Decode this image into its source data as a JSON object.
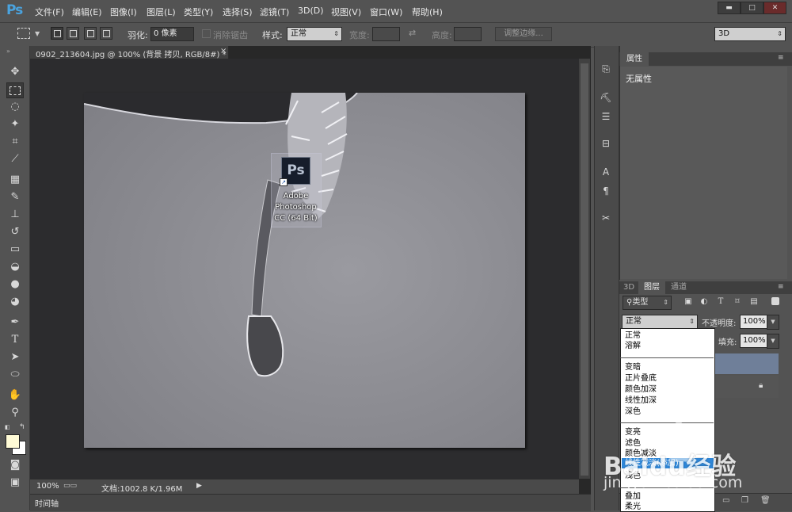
{
  "app": {
    "logo": "Ps"
  },
  "menu": [
    "文件(F)",
    "编辑(E)",
    "图像(I)",
    "图层(L)",
    "类型(Y)",
    "选择(S)",
    "滤镜(T)",
    "3D(D)",
    "视图(V)",
    "窗口(W)",
    "帮助(H)"
  ],
  "window_controls": {
    "minimize": "▬",
    "maximize": "□",
    "close": "✕"
  },
  "options": {
    "feather_label": "羽化:",
    "feather_value": "0 像素",
    "antialias_label": "消除锯齿",
    "style_label": "样式:",
    "style_value": "正常",
    "width_label": "宽度:",
    "height_label": "高度:",
    "refine_edge": "调整边缘...",
    "workspace": "3D"
  },
  "document": {
    "tab_title": "0902_213604.jpg @ 100% (背景 拷贝, RGB/8#) *",
    "close_glyph": "×",
    "zoom": "100%",
    "doc_size": "文档:1002.8 K/1.96M",
    "timeline": "时间轴"
  },
  "desktop_shortcut": {
    "icon_text": "Ps",
    "line1": "Adobe",
    "line2": "Photoshop",
    "line3": "CC (64 Bit)"
  },
  "properties": {
    "tab": "属性",
    "empty_text": "无属性"
  },
  "layers": {
    "tabs": [
      "3D",
      "图层",
      "通道"
    ],
    "filter_label": "类型",
    "blend_mode": "正常",
    "opacity_label": "不透明度:",
    "opacity_value": "100%",
    "fill_label": "填充:",
    "fill_value": "100%"
  },
  "blend_modes": {
    "group1": [
      "正常",
      "溶解"
    ],
    "group2": [
      "变暗",
      "正片叠底",
      "颜色加深",
      "线性加深",
      "深色"
    ],
    "group3": [
      "变亮",
      "滤色",
      "颜色减淡",
      "线性减淡(添加)",
      "浅色"
    ],
    "group4": [
      "叠加",
      "柔光"
    ],
    "highlighted": "线性减淡(添加)"
  },
  "watermark": {
    "logo": "Baidu经验",
    "url": "jingyan.baidu.com"
  },
  "colors": {
    "ui_bg": "#535353",
    "accent": "#2f87d8",
    "foreground_swatch": "#fffbd6",
    "background_swatch": "#ffffff"
  }
}
